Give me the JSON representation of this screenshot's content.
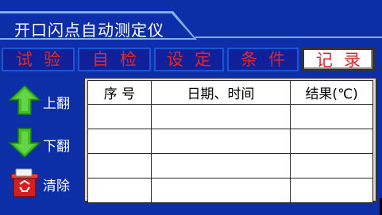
{
  "app": {
    "title": "开口闪点自动测定仪"
  },
  "tabs": [
    {
      "label": "试验"
    },
    {
      "label": "自检"
    },
    {
      "label": "设定"
    },
    {
      "label": "条件"
    },
    {
      "label": "记录",
      "active": true
    }
  ],
  "side": {
    "up_label": "上翻",
    "down_label": "下翻",
    "clear_label": "清除"
  },
  "table": {
    "headers": [
      "序 号",
      "日期、时间",
      "结果(℃)"
    ],
    "rows": [
      [
        "",
        "",
        ""
      ],
      [
        "",
        "",
        ""
      ],
      [
        "",
        "",
        ""
      ],
      [
        "",
        "",
        ""
      ]
    ]
  },
  "colors": {
    "background": "#0c2fa8",
    "accent": "#7fb0e8",
    "tab_text": "#e0282a",
    "arrow_green": "#3fbf2a"
  },
  "icons": {
    "up": "arrow-up-icon",
    "down": "arrow-down-icon",
    "clear": "recycle-bin-icon"
  }
}
